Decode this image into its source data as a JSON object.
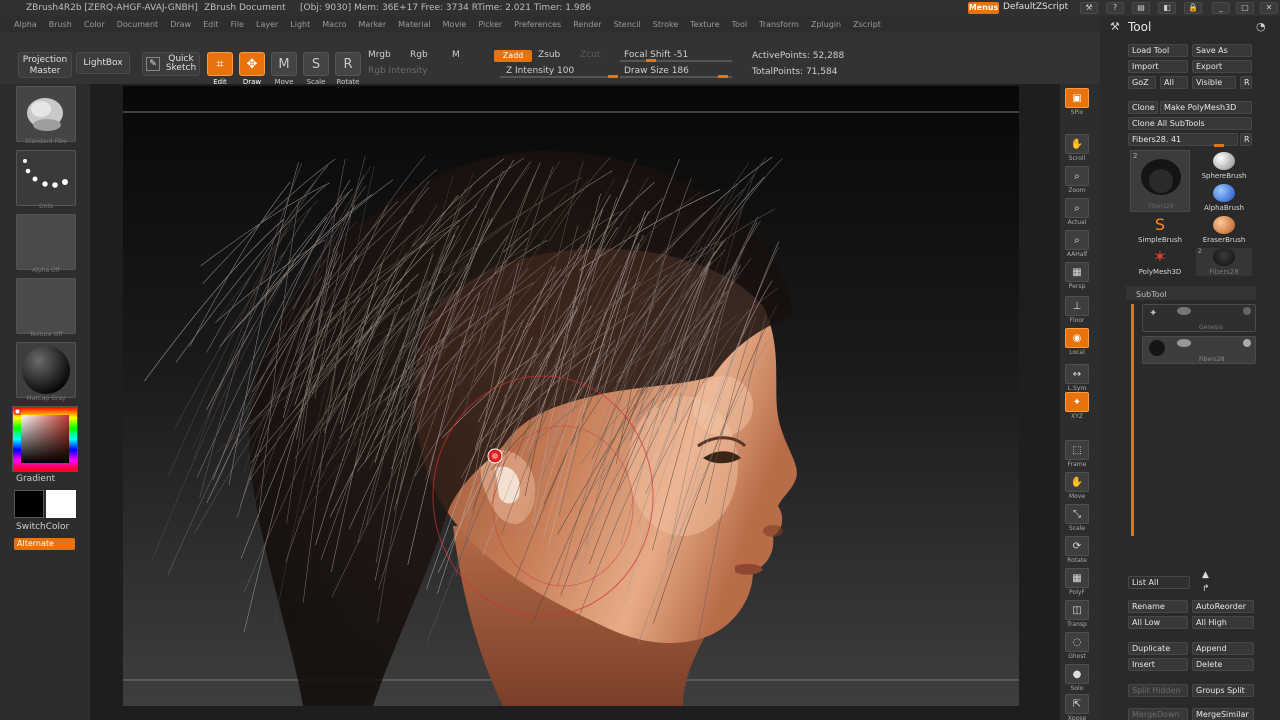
{
  "titlebar": {
    "app": "ZBrush4R2b [ZERQ-AHGF-AVAJ-GNBH]",
    "document": "ZBrush Document",
    "stats": "[Obj: 9030] Mem: 36E+17 Free: 3734 RTime: 2.021 Timer: 1.986",
    "menus_label": "Menus",
    "script_label": "DefaultZScript"
  },
  "menubar": {
    "items": [
      "Alpha",
      "Brush",
      "Color",
      "Document",
      "Draw",
      "Edit",
      "File",
      "Layer",
      "Light",
      "Macro",
      "Marker",
      "Material",
      "Movie",
      "Picker",
      "Preferences",
      "Render",
      "Stencil",
      "Stroke",
      "Texture",
      "Tool",
      "Transform",
      "Zplugin",
      "Zscript"
    ]
  },
  "shelf": {
    "projection_master": "Projection Master",
    "lightbox": "LightBox",
    "quick_sketch": "Quick Sketch",
    "edit": "Edit",
    "draw": "Draw",
    "move": "Move",
    "scale": "Scale",
    "rotate": "Rotate",
    "mrgb": "Mrgb",
    "rgb": "Rgb",
    "m": "M",
    "rgb_intensity": "Rgb Intensity",
    "zadd": "Zadd",
    "zsub": "Zsub",
    "zcut": "Zcut",
    "z_intensity": "Z Intensity 100",
    "focal_shift": "Focal Shift -51",
    "draw_size": "Draw Size 186",
    "active_points": "ActivePoints: 52,288",
    "total_points": "TotalPoints: 71,584"
  },
  "lefttray": {
    "brush_label": "Standard Fibe",
    "stroke_label": "Dots",
    "alpha_label": "Alpha Off",
    "texture_label": "Texture Off",
    "material_label": "MatCap Gray",
    "gradient": "Gradient",
    "switchcolor": "SwitchColor",
    "alternate": "Alternate"
  },
  "righttray": {
    "items": [
      "SPix",
      "Scroll",
      "Zoom",
      "Actual",
      "AAHalf",
      "Persp",
      "Floor",
      "Local",
      "L.Sym",
      "XYZ",
      "Frame",
      "Move",
      "Scale",
      "Rotate",
      "PolyF",
      "Transp",
      "Ghost",
      "Solo",
      "Xpose"
    ]
  },
  "toolpalette": {
    "title": "Tool",
    "load_tool": "Load Tool",
    "save_as": "Save As",
    "import": "Import",
    "export": "Export",
    "goz": "GoZ",
    "all": "All",
    "visible": "Visible",
    "r": "R",
    "clone": "Clone",
    "make_polymesh": "Make PolyMesh3D",
    "clone_all": "Clone All SubTools",
    "fibers_slider": "Fibers28. 41",
    "tools": {
      "current_count": "2",
      "current_name": "Fibers28",
      "sphere": "SphereBrush",
      "alpha": "AlphaBrush",
      "simple": "SimpleBrush",
      "eraser": "EraserBrush",
      "polymesh": "PolyMesh3D",
      "fibers": "Fibers28",
      "fibers_count": "2"
    },
    "subtool": "SubTool",
    "subtools": [
      "Genesis",
      "Fibers28"
    ],
    "list_all": "List All",
    "rename": "Rename",
    "autoreorder": "AutoReorder",
    "all_low": "All Low",
    "all_high": "All High",
    "duplicate": "Duplicate",
    "append": "Append",
    "insert": "Insert",
    "delete": "Delete",
    "split_hidden": "Split Hidden",
    "groups_split": "Groups Split",
    "merge_down": "MergeDown",
    "merge_similar": "MergeSimilar"
  },
  "colors": {
    "accent": "#e8720c",
    "panel": "#2a2a2a",
    "button": "#383838"
  }
}
